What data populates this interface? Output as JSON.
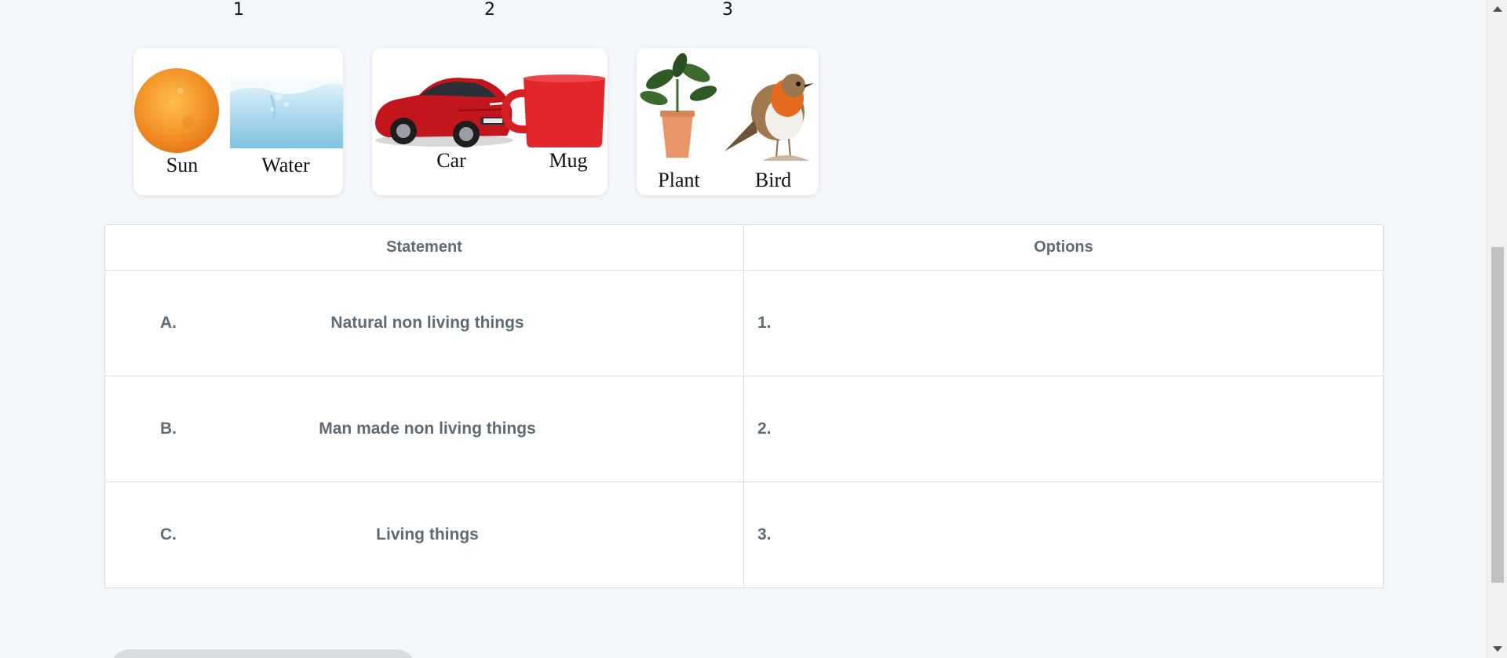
{
  "images": [
    {
      "number": "1",
      "captions": [
        "Sun",
        "Water"
      ]
    },
    {
      "number": "2",
      "captions": [
        "Car",
        "Mug"
      ]
    },
    {
      "number": "3",
      "captions": [
        "Plant",
        "Bird"
      ]
    }
  ],
  "table": {
    "headers": {
      "statement": "Statement",
      "options": "Options"
    },
    "rows": [
      {
        "letter": "A.",
        "statement": "Natural non living things",
        "option": "1."
      },
      {
        "letter": "B.",
        "statement": "Man made non living things",
        "option": "2."
      },
      {
        "letter": "C.",
        "statement": "Living things",
        "option": "3."
      }
    ]
  }
}
